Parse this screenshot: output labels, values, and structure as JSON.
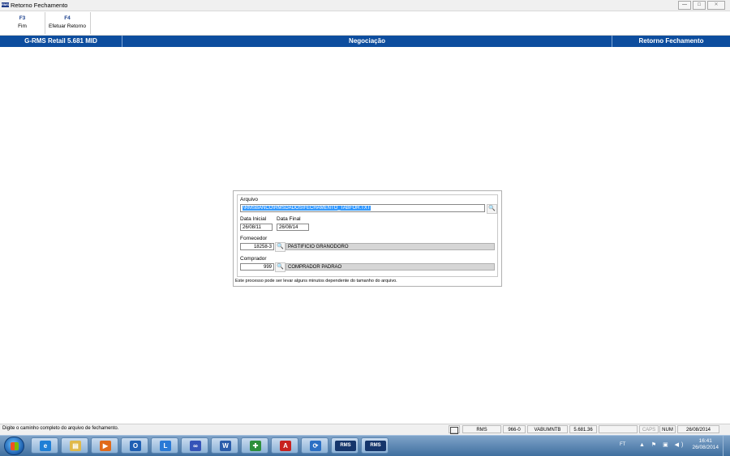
{
  "window": {
    "title": "Retorno Fechamento",
    "app_icon": "RMS",
    "minimize": "—",
    "maximize": "□",
    "close": "✕"
  },
  "toolbar": [
    {
      "key": "F3",
      "label": "Fim"
    },
    {
      "key": "F4",
      "label": "Efetuar Retorno"
    }
  ],
  "header": {
    "product": "G-RMS Retail 5.681 MID",
    "module": "Negociação",
    "screen": "Retorno Fechamento"
  },
  "form": {
    "arquivo_label": "Arquivo",
    "arquivo_value": "\\RMSBANCO\\RMSDADOS\\FECHAMENTO_TABFOR.TXT",
    "data_inicial_label": "Data Inicial",
    "data_inicial_value": "26/08/11",
    "data_final_label": "Data Final",
    "data_final_value": "26/08/14",
    "fornecedor_label": "Fornecedor",
    "fornecedor_code": "18258-3",
    "fornecedor_name": "PASTIFICIO GRANODORO",
    "comprador_label": "Comprador",
    "comprador_code": "999",
    "comprador_name": "COMPRADOR PADRAO",
    "search_glyph": "🔍",
    "note": "Este processo pode ser levar alguns minutos dependente do tamanho do arquivo."
  },
  "statusbar": {
    "message": "Digite o caminho completo do arquivo de fechamento.",
    "system": "RMS",
    "code": "966-0",
    "user": "VABUMNTB",
    "version": "5.681.36",
    "caps": "CAPS",
    "num": "NUM",
    "date": "26/08/2014"
  },
  "taskbar": {
    "language": "FT",
    "time": "16:41",
    "date": "26/08/2014",
    "tray_icons": "▲ ⚑ ▣ ◀)",
    "apps": [
      {
        "name": "ie",
        "glyph": "e",
        "color": "#1f7fd6"
      },
      {
        "name": "explorer",
        "glyph": "▤",
        "color": "#e0b94a"
      },
      {
        "name": "media-player",
        "glyph": "▶",
        "color": "#e06a1b"
      },
      {
        "name": "outlook",
        "glyph": "O",
        "color": "#1f5fb3"
      },
      {
        "name": "lync",
        "glyph": "L",
        "color": "#2a7ad6"
      },
      {
        "name": "connect",
        "glyph": "∞",
        "color": "#3553b8"
      },
      {
        "name": "word",
        "glyph": "W",
        "color": "#2a5caa"
      },
      {
        "name": "installer",
        "glyph": "✚",
        "color": "#2d8f3c"
      },
      {
        "name": "acrobat",
        "glyph": "A",
        "color": "#c8211f"
      },
      {
        "name": "remote",
        "glyph": "⟳",
        "color": "#2a6fc4"
      },
      {
        "name": "rms-1",
        "glyph": "RMS",
        "color": "#15356b"
      },
      {
        "name": "rms-2",
        "glyph": "RMS",
        "color": "#15356b"
      }
    ]
  }
}
